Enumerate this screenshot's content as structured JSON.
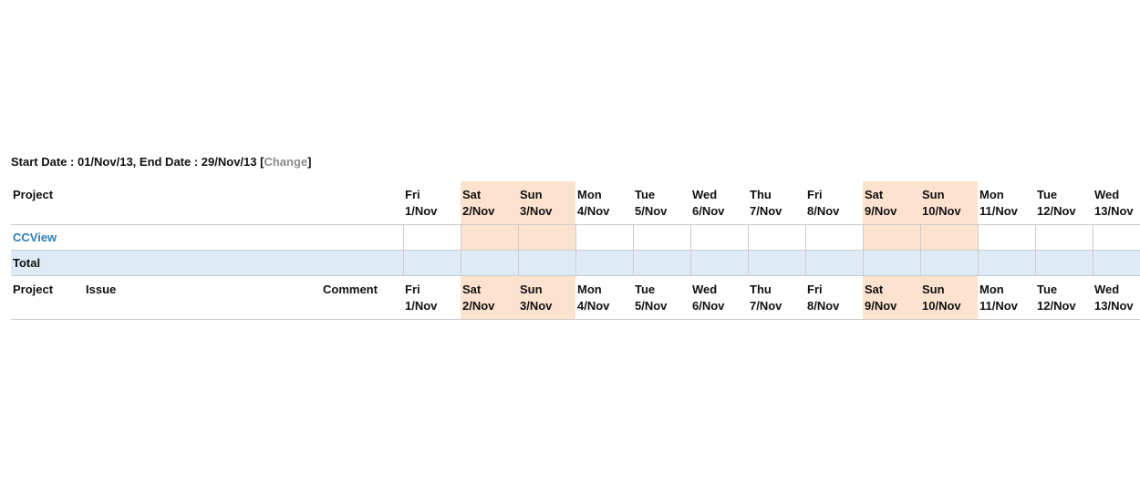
{
  "dateRange": {
    "label_start": "Start Date : ",
    "start": "01/Nov/13",
    "label_sep": ", End Date : ",
    "end": "29/Nov/13",
    "bracket_open": " [",
    "change": "Change",
    "bracket_close": "]"
  },
  "columns": {
    "project": "Project",
    "issue": "Issue",
    "comment": "Comment",
    "total": "Total"
  },
  "days": [
    {
      "dow": "Fri",
      "date": "1/Nov",
      "weekend": false
    },
    {
      "dow": "Sat",
      "date": "2/Nov",
      "weekend": true
    },
    {
      "dow": "Sun",
      "date": "3/Nov",
      "weekend": true
    },
    {
      "dow": "Mon",
      "date": "4/Nov",
      "weekend": false
    },
    {
      "dow": "Tue",
      "date": "5/Nov",
      "weekend": false
    },
    {
      "dow": "Wed",
      "date": "6/Nov",
      "weekend": false
    },
    {
      "dow": "Thu",
      "date": "7/Nov",
      "weekend": false
    },
    {
      "dow": "Fri",
      "date": "8/Nov",
      "weekend": false
    },
    {
      "dow": "Sat",
      "date": "9/Nov",
      "weekend": true
    },
    {
      "dow": "Sun",
      "date": "10/Nov",
      "weekend": true
    },
    {
      "dow": "Mon",
      "date": "11/Nov",
      "weekend": false
    },
    {
      "dow": "Tue",
      "date": "12/Nov",
      "weekend": false
    },
    {
      "dow": "Wed",
      "date": "13/Nov",
      "weekend": false
    }
  ],
  "projects": [
    {
      "name": "CCView"
    }
  ]
}
